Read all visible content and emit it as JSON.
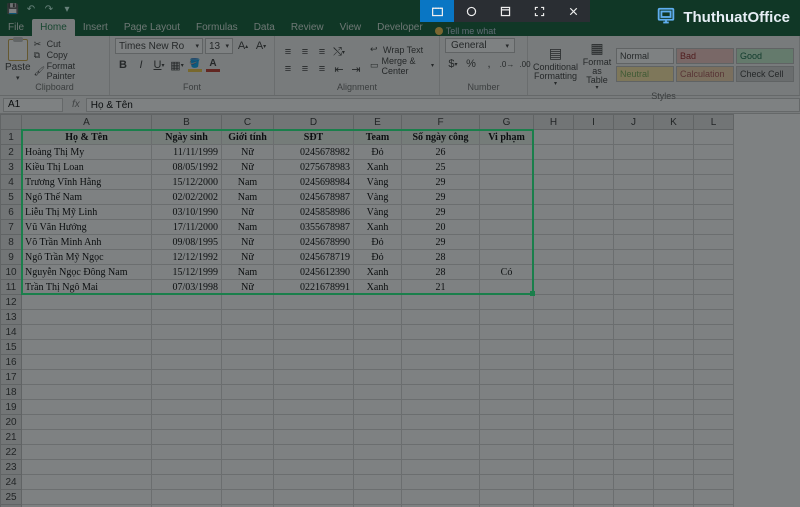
{
  "qat": {
    "save": "Save",
    "undo": "Undo",
    "redo": "Redo"
  },
  "menus": [
    "File",
    "Home",
    "Insert",
    "Page Layout",
    "Formulas",
    "Data",
    "Review",
    "View",
    "Developer"
  ],
  "active_menu": "Home",
  "tellme": "Tell me what",
  "ribbon": {
    "clipboard": {
      "paste": "Paste",
      "cut": "Cut",
      "copy": "Copy",
      "fp": "Format Painter",
      "label": "Clipboard"
    },
    "font": {
      "family": "Times New Ro",
      "size": "13",
      "label": "Font"
    },
    "alignment": {
      "wrap": "Wrap Text",
      "merge": "Merge & Center",
      "label": "Alignment"
    },
    "number": {
      "format": "General",
      "label": "Number"
    },
    "styles": {
      "cond": "Conditional Formatting",
      "fat": "Format as Table",
      "normal": "Normal",
      "bad": "Bad",
      "good": "Good",
      "neutral": "Neutral",
      "calc": "Calculation",
      "check": "Check Cell",
      "label": "Styles"
    }
  },
  "namebox": "A1",
  "fx_label": "fx",
  "fx_value": "Họ & Tên",
  "cols_data": [
    "A",
    "B",
    "C",
    "D",
    "E",
    "F",
    "G"
  ],
  "cols_empty": [
    "H",
    "I",
    "J",
    "K",
    "L"
  ],
  "header_row": [
    "Họ & Tên",
    "Ngày sinh",
    "Giới tính",
    "SĐT",
    "Team",
    "Số ngày công",
    "Vi phạm"
  ],
  "rows": [
    {
      "n": "Hoàng Thị My",
      "d": "11/11/1999",
      "g": "Nữ",
      "p": "0245678982",
      "t": "Đỏ",
      "c": "26",
      "v": ""
    },
    {
      "n": "Kiều Thị Loan",
      "d": "08/05/1992",
      "g": "Nữ",
      "p": "0275678983",
      "t": "Xanh",
      "c": "25",
      "v": ""
    },
    {
      "n": "Trương Vĩnh Hằng",
      "d": "15/12/2000",
      "g": "Nam",
      "p": "0245698984",
      "t": "Vàng",
      "c": "29",
      "v": ""
    },
    {
      "n": "Ngô Thế Nam",
      "d": "02/02/2002",
      "g": "Nam",
      "p": "0245678987",
      "t": "Vàng",
      "c": "29",
      "v": ""
    },
    {
      "n": "Liễu Thị Mỹ Linh",
      "d": "03/10/1990",
      "g": "Nữ",
      "p": "0245858986",
      "t": "Vàng",
      "c": "29",
      "v": ""
    },
    {
      "n": "Vũ Văn Hướng",
      "d": "17/11/2000",
      "g": "Nam",
      "p": "0355678987",
      "t": "Xanh",
      "c": "20",
      "v": ""
    },
    {
      "n": "Võ Trần Minh Anh",
      "d": "09/08/1995",
      "g": "Nữ",
      "p": "0245678990",
      "t": "Đỏ",
      "c": "29",
      "v": ""
    },
    {
      "n": "Ngô Trần Mỹ Ngọc",
      "d": "12/12/1992",
      "g": "Nữ",
      "p": "0245678719",
      "t": "Đỏ",
      "c": "28",
      "v": ""
    },
    {
      "n": "Nguyễn Ngọc Đông Nam",
      "d": "15/12/1999",
      "g": "Nam",
      "p": "0245612390",
      "t": "Xanh",
      "c": "28",
      "v": "Có"
    },
    {
      "n": "Trần Thị Ngô Mai",
      "d": "07/03/1998",
      "g": "Nữ",
      "p": "0221678991",
      "t": "Xanh",
      "c": "21",
      "v": ""
    }
  ],
  "watermark": "ThuthuatOffice"
}
